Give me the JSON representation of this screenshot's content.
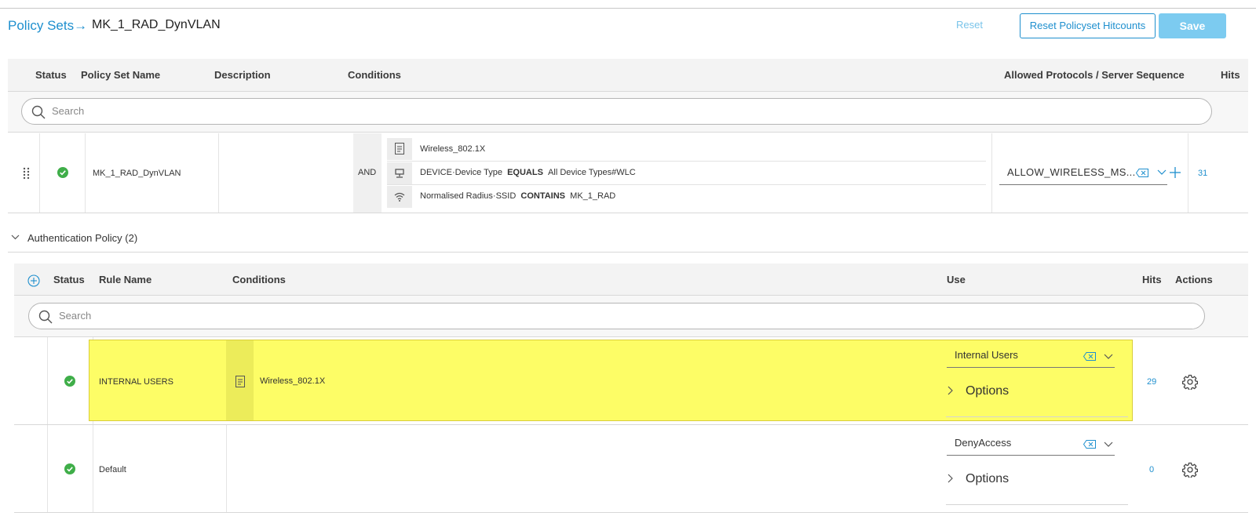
{
  "header": {
    "breadcrumb_link": "Policy Sets",
    "breadcrumb_arrow": "→",
    "breadcrumb_current": "MK_1_RAD_DynVLAN",
    "reset_label": "Reset",
    "reset_hitcounts_label": "Reset Policyset Hitcounts",
    "save_label": "Save"
  },
  "policy_sets": {
    "columns": [
      "Status",
      "Policy Set Name",
      "Description",
      "Conditions",
      "Allowed Protocols / Server Sequence",
      "Hits"
    ],
    "search_placeholder": "Search",
    "row": {
      "name": "MK_1_RAD_DynVLAN",
      "operator": "AND",
      "conditions": [
        {
          "icon": "document-icon",
          "text": "Wireless_802.1X"
        },
        {
          "icon": "device-icon",
          "attr": "DEVICE·Device Type",
          "op": "EQUALS",
          "value": "All Device Types#WLC"
        },
        {
          "icon": "wifi-icon",
          "attr": "Normalised Radius·SSID",
          "op": "CONTAINS",
          "value": "MK_1_RAD"
        }
      ],
      "allowed_protocols": "ALLOW_WIRELESS_MS...",
      "hits": "31"
    }
  },
  "auth_policy": {
    "title": "Authentication Policy (2)",
    "columns": [
      "Status",
      "Rule Name",
      "Conditions",
      "Use",
      "Hits",
      "Actions"
    ],
    "search_placeholder": "Search",
    "rules": [
      {
        "name": "INTERNAL USERS",
        "condition": "Wireless_802.1X",
        "use": "Internal Users",
        "options_label": "Options",
        "hits": "29"
      },
      {
        "name": "Default",
        "condition": "",
        "use": "DenyAccess",
        "options_label": "Options",
        "hits": "0"
      }
    ]
  },
  "colors": {
    "accent": "#1e8fce",
    "success": "#3fae49",
    "highlight": "#fdfd66"
  }
}
